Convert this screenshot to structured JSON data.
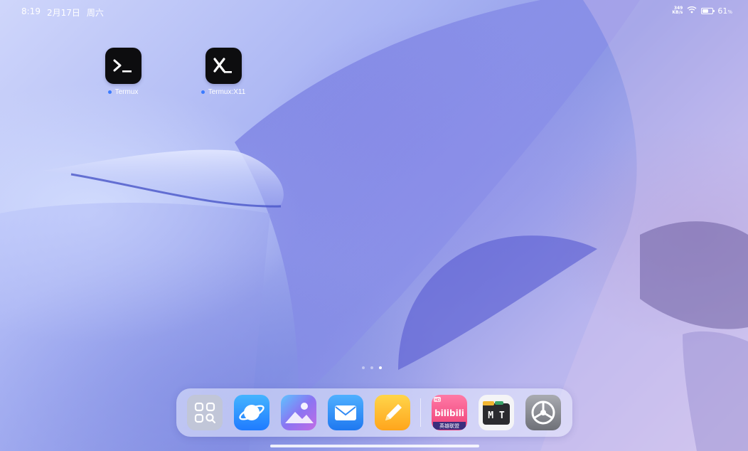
{
  "status_bar": {
    "time": "8:19",
    "date": "2月17日",
    "weekday": "周六",
    "net_speed_value": "349",
    "net_speed_unit": "KB/s",
    "battery_percent": "61",
    "battery_level": 0.61,
    "icons": [
      "wifi-icon",
      "battery-icon"
    ]
  },
  "desktop": {
    "apps": [
      {
        "label": "Termux",
        "icon": "termux-icon",
        "glyph": "≻_"
      },
      {
        "label": "Termux:X11",
        "icon": "termux-x11-icon",
        "glyph": "X_"
      }
    ]
  },
  "page_indicator": {
    "count": 3,
    "active_index": 3
  },
  "dock": {
    "apps": [
      {
        "name": "app-drawer",
        "icon": "app-drawer-icon"
      },
      {
        "name": "browser",
        "icon": "browser-planet-icon",
        "color": "#3aa0ff"
      },
      {
        "name": "gallery",
        "icon": "gallery-icon",
        "color": "#7b6cf2"
      },
      {
        "name": "mail",
        "icon": "mail-icon",
        "color": "#2f95ff"
      },
      {
        "name": "notes",
        "icon": "notes-pencil-icon",
        "color": "#ffb21f"
      },
      {
        "name": "bilibili",
        "icon": "bilibili-icon",
        "color": "#f25d8e",
        "text_top": "bilibili",
        "text_bottom": "英雄联盟",
        "badge": "HD"
      },
      {
        "name": "mt-manager",
        "icon": "mt-manager-icon",
        "text": "M T"
      },
      {
        "name": "settings",
        "icon": "settings-gear-icon",
        "color": "#8a8c91"
      }
    ]
  }
}
